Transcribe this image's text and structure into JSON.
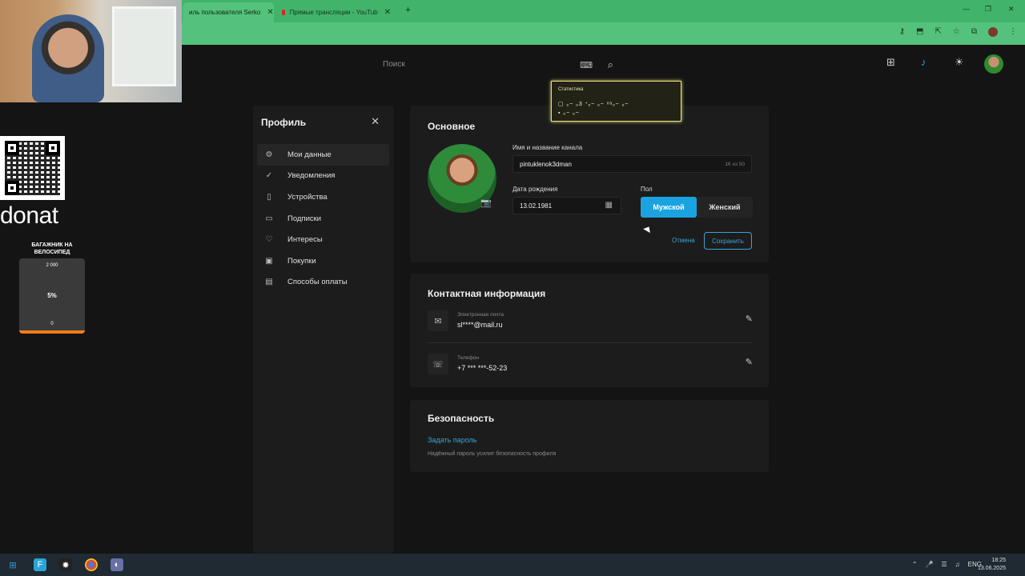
{
  "browser": {
    "tabs": [
      {
        "label": "иль пользователя Serko",
        "active": true
      },
      {
        "label": "Прямые трансляции - YouTub",
        "active": false
      }
    ],
    "new_tab": "+",
    "win_min": "—",
    "win_max": "❐",
    "win_close": "✕"
  },
  "site": {
    "search_placeholder": "Поиск"
  },
  "profile": {
    "title": "Профиль",
    "menu": [
      {
        "label": "Мои данные",
        "icon": "gear-icon",
        "glyph": "⚙",
        "active": true
      },
      {
        "label": "Уведомления",
        "icon": "notification-icon",
        "glyph": "✓",
        "active": false
      },
      {
        "label": "Устройства",
        "icon": "device-icon",
        "glyph": "▯",
        "active": false
      },
      {
        "label": "Подписки",
        "icon": "subscription-icon",
        "glyph": "▭",
        "active": false
      },
      {
        "label": "Интересы",
        "icon": "heart-icon",
        "glyph": "♡",
        "active": false
      },
      {
        "label": "Покупки",
        "icon": "purchases-icon",
        "glyph": "▣",
        "active": false
      },
      {
        "label": "Способы оплаты",
        "icon": "wallet-icon",
        "glyph": "▤",
        "active": false
      }
    ]
  },
  "basic": {
    "title": "Основное",
    "name_label": "Имя и название канала",
    "name_value": "pintuklenok3dman",
    "name_counter": "16 из 50",
    "birth_label": "Дата рождения",
    "birth_value": "13.02.1981",
    "gender_label": "Пол",
    "gender_male": "Мужской",
    "gender_female": "Женский",
    "gender_selected": "Мужской",
    "cancel": "Отмена",
    "save": "Сохранить"
  },
  "contact": {
    "title": "Контактная информация",
    "email_label": "Электронная почта",
    "email_value": "sl****@mail.ru",
    "phone_label": "Телефон",
    "phone_value": "+7 *** ***-52-23"
  },
  "security": {
    "title": "Безопасность",
    "set_password": "Задать пароль",
    "hint": "Надёжный пароль усилит безопасность профиля"
  },
  "stats_overlay": {
    "title": "Статистика",
    "row1": "▢ ₒ~ ₒ3 ᐩₒ~ ₒ~ ᵒᵃₒ~ ₒ~",
    "row2": "▪ ₒ~ ₒ~"
  },
  "stream": {
    "donat_text": "donat",
    "goal_title": "БАГАЖНИК НА ВЕЛОСИПЕД",
    "goal_target": "2 000",
    "goal_percent": "5%",
    "goal_start": "0",
    "goal_progress": 0.05
  },
  "taskbar": {
    "lang": "ENG",
    "time": "18:25",
    "date": "13.06.2025"
  },
  "colors": {
    "accent": "#1aa3e0",
    "browser_green": "#54c27c",
    "page_bg": "#141414",
    "card_bg": "#1c1c1c",
    "goal_bar": "#f07f1a"
  }
}
